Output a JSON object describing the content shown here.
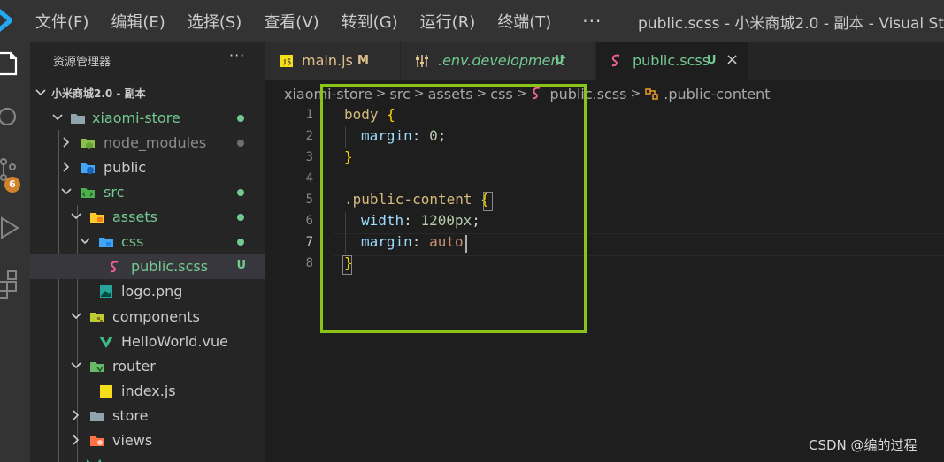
{
  "titlebar": {
    "menu": [
      "文件(F)",
      "编辑(E)",
      "选择(S)",
      "查看(V)",
      "转到(G)",
      "运行(R)",
      "终端(T)"
    ],
    "more": "···",
    "window_title": "public.scss - 小米商城2.0 - 副本 - Visual Stu"
  },
  "activity": {
    "icons": [
      "vscode-logo-icon",
      "explorer-icon",
      "search-icon",
      "source-control-icon",
      "run-debug-icon",
      "extensions-icon"
    ],
    "scm_badge": "6"
  },
  "sidebar": {
    "header": "资源管理器",
    "more": "···",
    "workspace": "小米商城2.0 - 副本",
    "tree": [
      {
        "label": "xiaomi-store",
        "type": "folder-open",
        "color": "#73c991",
        "status": "dot"
      },
      {
        "label": "node_modules",
        "type": "folder",
        "color": "#8c8c8c",
        "status": "dot"
      },
      {
        "label": "public",
        "type": "folder",
        "color": "#cccccc",
        "status": ""
      },
      {
        "label": "src",
        "type": "folder-open",
        "color": "#73c991",
        "status": "dot"
      },
      {
        "label": "assets",
        "type": "folder-open",
        "color": "#73c991",
        "status": "dot"
      },
      {
        "label": "css",
        "type": "folder-open",
        "color": "#73c991",
        "status": "dot"
      },
      {
        "label": "public.scss",
        "type": "scss",
        "color": "#73c991",
        "status": "U"
      },
      {
        "label": "logo.png",
        "type": "image",
        "color": "#cccccc",
        "status": ""
      },
      {
        "label": "components",
        "type": "folder-open",
        "color": "#cccccc",
        "status": ""
      },
      {
        "label": "HelloWorld.vue",
        "type": "vue",
        "color": "#cccccc",
        "status": ""
      },
      {
        "label": "router",
        "type": "folder-open",
        "color": "#cccccc",
        "status": ""
      },
      {
        "label": "index.js",
        "type": "js",
        "color": "#cccccc",
        "status": ""
      },
      {
        "label": "store",
        "type": "folder",
        "color": "#cccccc",
        "status": ""
      },
      {
        "label": "views",
        "type": "folder",
        "color": "#cccccc",
        "status": ""
      }
    ]
  },
  "tabs": [
    {
      "label": "main.js",
      "status": "M",
      "icon": "js-file-icon",
      "color": "#e2c08d",
      "active": false
    },
    {
      "label": ".env.development",
      "status": "U",
      "icon": "env-settings-icon",
      "color": "#73c991",
      "active": false
    },
    {
      "label": "public.scss",
      "status": "U",
      "icon": "scss-file-icon",
      "color": "#73c991",
      "active": true,
      "close": "×"
    }
  ],
  "breadcrumb": [
    "xiaomi-store",
    "src",
    "assets",
    "css",
    "public.scss",
    ".public-content"
  ],
  "editor": {
    "line_numbers": [
      "1",
      "2",
      "3",
      "4",
      "5",
      "6",
      "7",
      "8"
    ],
    "current_line": "7",
    "lines": [
      {
        "selector": "body",
        "brace": " {"
      },
      {
        "prop": "margin",
        "colon": ": ",
        "num": "0",
        "semi": ";"
      },
      {
        "close": "}"
      },
      {},
      {
        "selector": ".public-content",
        "brace": " {"
      },
      {
        "prop": "width",
        "colon": ": ",
        "num": "1200",
        "unit": "px",
        "semi": ";"
      },
      {
        "prop": "margin",
        "colon": ": ",
        "val": "auto"
      },
      {
        "close": "}"
      }
    ]
  },
  "watermark": "CSDN @编的过程"
}
